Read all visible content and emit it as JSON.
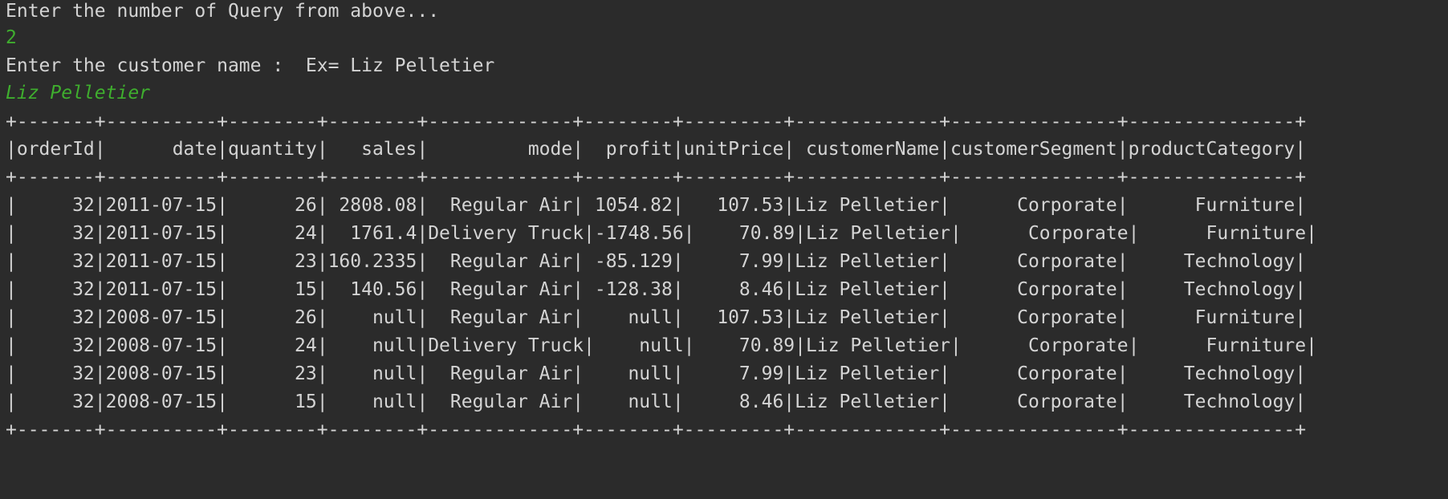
{
  "console": {
    "prompt_query": "Enter the number of Query from above...",
    "input_query": "2",
    "prompt_customer": "Enter the customer name :  Ex= Liz Pelletier",
    "input_customer": "Liz Pelletier",
    "table": {
      "border": "+-------+----------+--------+--------+-------------+--------+---------+-------------+---------------+---------------+",
      "header": "|orderId|      date|quantity|   sales|         mode|  profit|unitPrice| customerName|customerSegment|productCategory|",
      "rows": [
        "|     32|2011-07-15|      26| 2808.08|  Regular Air| 1054.82|   107.53|Liz Pelletier|      Corporate|      Furniture|",
        "|     32|2011-07-15|      24|  1761.4|Delivery Truck|-1748.56|    70.89|Liz Pelletier|      Corporate|      Furniture|",
        "|     32|2011-07-15|      23|160.2335|  Regular Air| -85.129|     7.99|Liz Pelletier|      Corporate|     Technology|",
        "|     32|2011-07-15|      15|  140.56|  Regular Air| -128.38|     8.46|Liz Pelletier|      Corporate|     Technology|",
        "|     32|2008-07-15|      26|    null|  Regular Air|    null|   107.53|Liz Pelletier|      Corporate|      Furniture|",
        "|     32|2008-07-15|      24|    null|Delivery Truck|    null|    70.89|Liz Pelletier|      Corporate|      Furniture|",
        "|     32|2008-07-15|      23|    null|  Regular Air|    null|     7.99|Liz Pelletier|      Corporate|     Technology|",
        "|     32|2008-07-15|      15|    null|  Regular Air|    null|     8.46|Liz Pelletier|      Corporate|     Technology|"
      ]
    }
  },
  "colors": {
    "background": "#2b2b2b",
    "text": "#d4d4d4",
    "user_input": "#3fae2e"
  }
}
